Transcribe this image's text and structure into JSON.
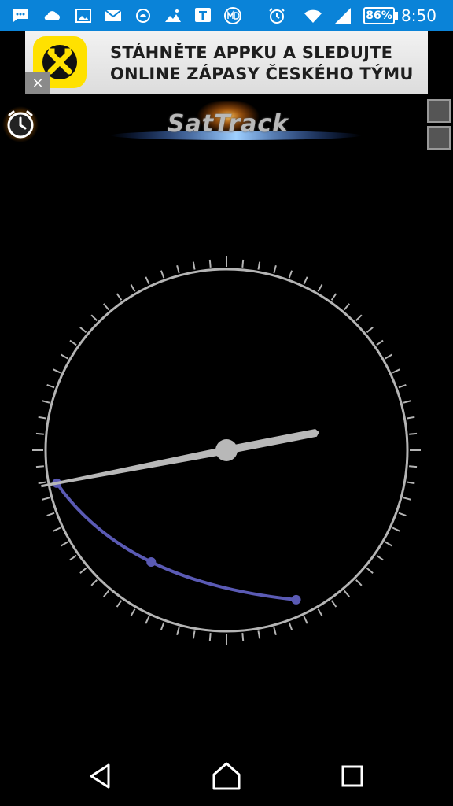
{
  "status_bar": {
    "battery": "86%",
    "time": "8:50",
    "icons": [
      "messages-icon",
      "cloud-icon",
      "gallery-icon",
      "gmail-icon",
      "weather-icon",
      "hiker-icon",
      "t-app-icon",
      "md-icon",
      "alarm-icon",
      "wifi-icon",
      "signal-icon"
    ]
  },
  "ad": {
    "line1": "STÁHNĚTE APPKU A SLEDUJTE",
    "line2": "ONLINE ZÁPASY ČESKÉHO TÝMU",
    "close_label": "×",
    "logo_icon": "raiffeisen-logo-icon"
  },
  "header": {
    "app_title": "SatTrack",
    "alarm_icon": "alarm-clock-icon"
  },
  "compass": {
    "ring_color": "#b4b4b4",
    "track_color": "#5a5ab4",
    "needle_color": "#b8b8b8",
    "needle_heading_deg": 79,
    "track_points": [
      {
        "azimuth_deg": 259,
        "elevation_deg": 4
      },
      {
        "azimuth_deg": 214,
        "elevation_deg": 23
      },
      {
        "azimuth_deg": 155,
        "elevation_deg": 8
      }
    ]
  },
  "nav": {
    "back_icon": "back-icon",
    "home_icon": "home-icon",
    "recents_icon": "recents-icon"
  }
}
